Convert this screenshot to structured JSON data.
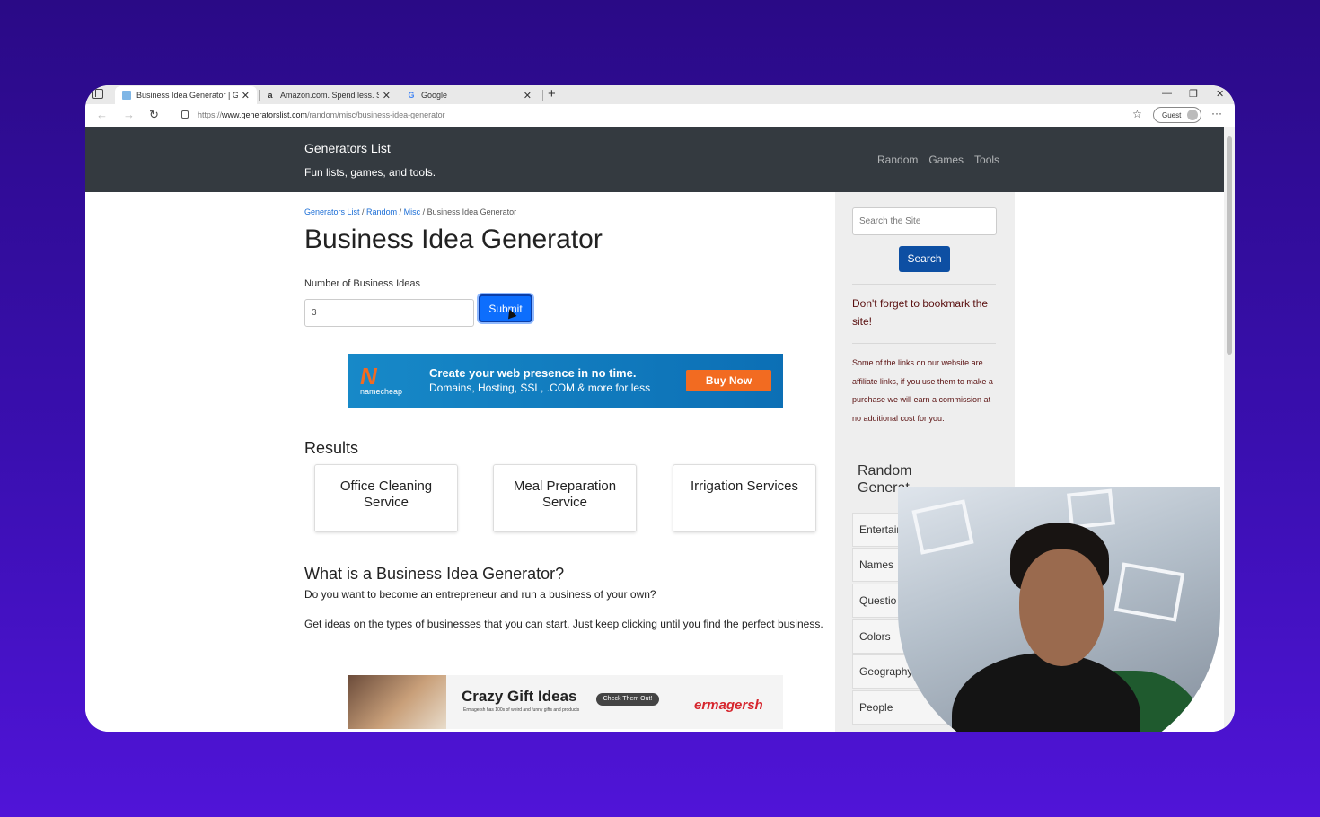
{
  "browser": {
    "tabs": [
      {
        "title": "Business Idea Generator | Gener",
        "favicon": "page-icon",
        "active": true
      },
      {
        "title": "Amazon.com. Spend less. Smile",
        "favicon": "a",
        "active": false
      },
      {
        "title": "Google",
        "favicon": "G",
        "active": false
      }
    ],
    "url_prefix": "https://",
    "url_host": "www.generatorslist.com",
    "url_path": "/random/misc/business-idea-generator",
    "profile_label": "Guest"
  },
  "site": {
    "brand": "Generators List",
    "tagline": "Fun lists, games, and tools.",
    "nav": [
      "Random",
      "Games",
      "Tools"
    ]
  },
  "breadcrumb": {
    "items": [
      "Generators List",
      "Random",
      "Misc"
    ],
    "current": "Business Idea Generator",
    "separator": " / "
  },
  "main": {
    "title": "Business Idea Generator",
    "number_label": "Number of Business Ideas",
    "number_value": "3",
    "submit_label": "Submit",
    "results_heading": "Results",
    "results": [
      "Office Cleaning Service",
      "Meal Preparation Service",
      "Irrigation Services"
    ],
    "what_heading": "What is a Business Idea Generator?",
    "paragraphs": [
      "Do you want to become an entrepreneur and run a business of your own?",
      "Get ideas on the types of businesses that you can start. Just keep clicking until you find the perfect business."
    ]
  },
  "ads": {
    "namecheap": {
      "logo_text": "namecheap",
      "line1": "Create your web presence in no time.",
      "line2": "Domains, Hosting, SSL, .COM & more for less",
      "button": "Buy Now"
    },
    "gifts": {
      "headline": "Crazy Gift Ideas",
      "subline": "Ermagersh has 100s of weird and funny gifts and products",
      "button": "Check Them Out!",
      "brand": "ermagersh"
    }
  },
  "sidebar": {
    "search_placeholder": "Search the Site",
    "search_button": "Search",
    "bookmark_note": "Don't forget to bookmark the site!",
    "affiliate_note": "Some of the links on our website are affiliate links, if you use them to make a purchase we will earn a commission at no additional cost for you.",
    "random_title": "Random Generat",
    "categories": [
      "Entertair",
      "Names",
      "Questio",
      "Colors",
      "Geography",
      "People"
    ]
  },
  "colors": {
    "background": "#3a0fb0",
    "header": "#343a40",
    "primary_button": "#0d6efd",
    "link": "#1a6dd6"
  }
}
